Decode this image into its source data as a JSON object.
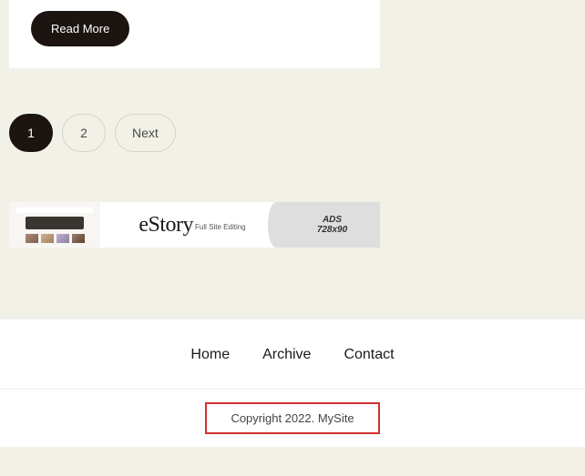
{
  "card": {
    "read_more": "Read More"
  },
  "pagination": {
    "pages": [
      "1",
      "2"
    ],
    "current_index": 0,
    "next_label": "Next"
  },
  "ad": {
    "logo": "eStory",
    "tagline": "Full Site Editing",
    "ads_label": "ADS",
    "ads_size": "728x90"
  },
  "footer": {
    "links": [
      "Home",
      "Archive",
      "Contact"
    ],
    "copyright": "Copyright 2022. MySite"
  }
}
